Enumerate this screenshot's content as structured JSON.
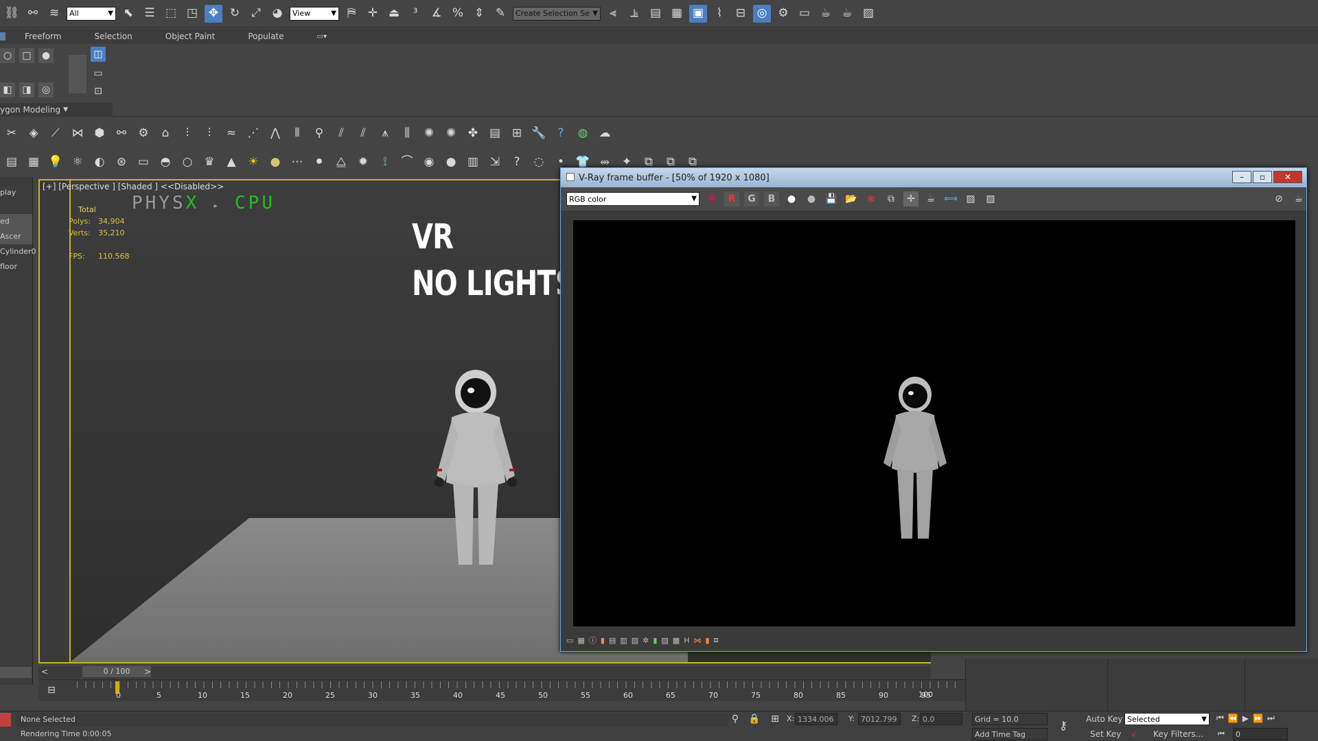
{
  "toolbar": {
    "filter_dropdown": "All",
    "ref_coord_dropdown": "View",
    "selection_set": "Create Selection Se"
  },
  "ribbon": {
    "tabs": [
      "Freeform",
      "Selection",
      "Object Paint",
      "Populate"
    ],
    "mode_label": "ygon Modeling"
  },
  "left_panel": {
    "items": [
      "play",
      "ed Ascer",
      "Cylinder0",
      "floor"
    ]
  },
  "viewport": {
    "label": "[+] [Perspective ] [Shaded ] <<Disabled>>",
    "physx_a": "PHYS",
    "physx_x": "X",
    "physx_arrow": "▸",
    "physx_cpu": "CPU",
    "stats": {
      "total": "Total",
      "polys_label": "Polys:",
      "polys": "34,904",
      "verts_label": "Verts:",
      "verts": "35,210",
      "fps_label": "FPS:",
      "fps": "110.568"
    }
  },
  "overlay": {
    "line1": "VR",
    "line2": "NO LIGHTS IN THE SCENE"
  },
  "framebuffer": {
    "title": "V-Ray frame buffer - [50% of 1920 x 1080]",
    "channel": "RGB color",
    "btn_r": "R",
    "btn_g": "G",
    "btn_b": "B",
    "status_h": "H"
  },
  "timeline": {
    "frame": "0 / 100",
    "prev": "<",
    "next": ">",
    "ticks": [
      "0",
      "5",
      "10",
      "15",
      "20",
      "25",
      "30",
      "35",
      "40",
      "45",
      "50",
      "55",
      "60",
      "65",
      "70",
      "75",
      "80",
      "85",
      "90",
      "95",
      "100"
    ]
  },
  "statusbar": {
    "selection": "None Selected",
    "render_time": "Rendering Time 0:00:05",
    "x_label": "X:",
    "x": "1334.006",
    "y_label": "Y:",
    "y": "7012.799",
    "z_label": "Z:",
    "z": "0.0",
    "grid": "Grid = 10.0",
    "add_time_tag": "Add Time Tag",
    "auto_key": "Auto Key",
    "set_key": "Set Key",
    "key_mode": "Selected",
    "key_filters": "Key Filters...",
    "current_frame": "0"
  },
  "colors": {
    "accent": "#4a7fc1",
    "viewport_border": "#c8b428",
    "stats_text": "#e0c03a",
    "physx_green": "#20c020"
  }
}
